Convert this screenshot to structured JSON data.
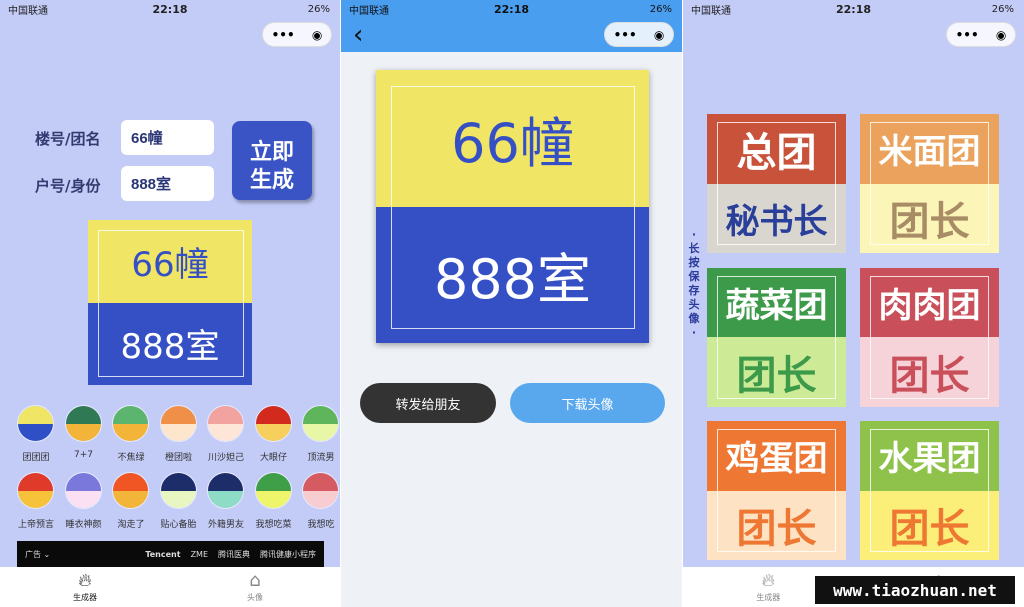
{
  "status": {
    "carrier": "中国联通",
    "time": "22:18",
    "battery": "26%"
  },
  "capsule": {
    "more": "•••",
    "close": "◉"
  },
  "generator": {
    "building_label": "楼号/团名",
    "building_value": "66幢",
    "room_label": "户号/身份",
    "room_value": "888室",
    "generate_button": "立即\n生成",
    "preview": {
      "top": "66幢",
      "bottom": "888室"
    },
    "themes": [
      {
        "name": "团团团",
        "top": "#f0e565",
        "bottom": "#2f4fc6"
      },
      {
        "name": "7+7",
        "top": "#2f7a55",
        "bottom": "#f3b43a"
      },
      {
        "name": "不焦绿",
        "top": "#5cb56f",
        "bottom": "#f3b43a"
      },
      {
        "name": "橙团啦",
        "top": "#f09048",
        "bottom": "#fde6cc"
      },
      {
        "name": "川沙妲己",
        "top": "#f2a3a0",
        "bottom": "#fde6d8"
      },
      {
        "name": "大眼仔",
        "top": "#d32a1e",
        "bottom": "#f6cf5c"
      },
      {
        "name": "顶流男",
        "top": "#5fb55c",
        "bottom": "#e8f7a6"
      },
      {
        "name": "上帝预言",
        "top": "#e03a2a",
        "bottom": "#f6c23a"
      },
      {
        "name": "睡衣神颜",
        "top": "#7b78dc",
        "bottom": "#fbe0f4"
      },
      {
        "name": "淘走了",
        "top": "#ef5624",
        "bottom": "#f3b43a"
      },
      {
        "name": "贴心备胎",
        "top": "#1d2d6a",
        "bottom": "#e8f7c2"
      },
      {
        "name": "外籍男友",
        "top": "#1d2d6a",
        "bottom": "#8fdcc6"
      },
      {
        "name": "我想吃菜",
        "top": "#3f9e48",
        "bottom": "#eef56a"
      },
      {
        "name": "我想吃",
        "top": "#d55a62",
        "bottom": "#f8cdd2"
      }
    ],
    "ad": {
      "label": "广告 ⌄",
      "brands": [
        "Tencent",
        "ZME",
        "腾讯医典",
        "腾讯健康小程序"
      ]
    }
  },
  "tabs": [
    {
      "label": "生成器",
      "icon": "flame-icon"
    },
    {
      "label": "头像",
      "icon": "home-icon"
    }
  ],
  "result": {
    "avatar": {
      "top": "66幢",
      "bottom": "888室"
    },
    "share_button": "转发给朋友",
    "download_button": "下载头像",
    "back": "‹"
  },
  "gallery": {
    "hint": "·长按保存头像·",
    "cards": [
      {
        "top": "总团",
        "bottom": "秘书长",
        "top_color": "#c9523a",
        "bottom_color": "#d9d6cf",
        "text_color": "#2a3f9a"
      },
      {
        "top": "米面团",
        "bottom": "团长",
        "top_color": "#eba25c",
        "bottom_color": "#fbf5b8",
        "text_color": "#a88c66"
      },
      {
        "top": "蔬菜团",
        "bottom": "团长",
        "top_color": "#3d9a4a",
        "bottom_color": "#cdeb96",
        "text_color": "#3d9a4a"
      },
      {
        "top": "肉肉团",
        "bottom": "团长",
        "top_color": "#c9505a",
        "bottom_color": "#f6d3d8",
        "text_color": "#c9505a"
      },
      {
        "top": "鸡蛋团",
        "bottom": "团长",
        "top_color": "#ee7733",
        "bottom_color": "#fde3c4",
        "text_color": "#ee7733"
      },
      {
        "top": "水果团",
        "bottom": "团长",
        "top_color": "#8fc24a",
        "bottom_color": "#fbef7a",
        "text_color": "#ee7733"
      }
    ]
  },
  "watermark": "www.tiaozhuan.net"
}
